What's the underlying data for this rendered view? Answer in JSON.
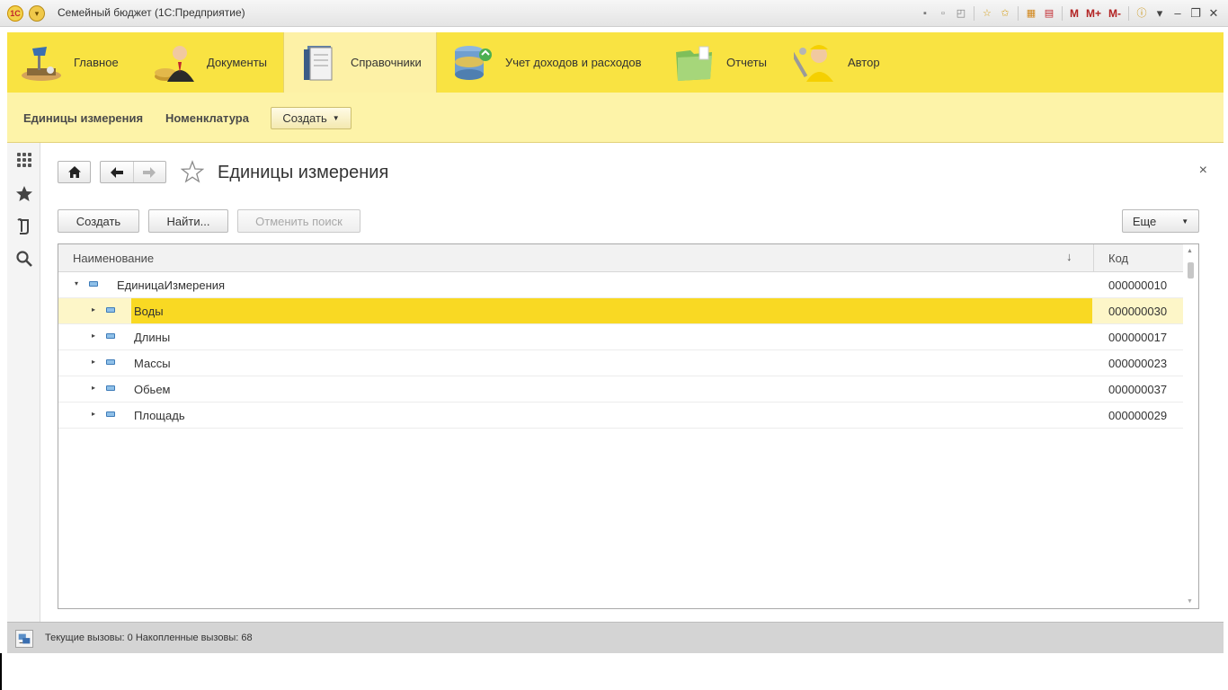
{
  "window": {
    "app_title": "Семейный бюджет (1С:Предприятие)",
    "logo_text": "1С",
    "toolbar_m": "M",
    "toolbar_m_plus": "M+",
    "toolbar_m_minus": "M-"
  },
  "sections": [
    {
      "label": "Главное",
      "icon": "desk-lamp-icon"
    },
    {
      "label": "Документы",
      "icon": "businessman-coins-icon"
    },
    {
      "label": "Справочники",
      "icon": "book-icon",
      "active": true
    },
    {
      "label": "Учет доходов и расходов",
      "icon": "database-coins-icon"
    },
    {
      "label": "Отчеты",
      "icon": "green-folder-icon"
    },
    {
      "label": "Автор",
      "icon": "worker-wrench-icon"
    }
  ],
  "section_nav": {
    "link1": "Единицы измерения",
    "link2": "Номенклатура",
    "create": "Создать"
  },
  "form": {
    "title": "Единицы измерения",
    "close": "×",
    "buttons": {
      "create": "Создать",
      "find": "Найти...",
      "cancel_search": "Отменить поиск",
      "more": "Еще"
    }
  },
  "table": {
    "col_name": "Наименование",
    "col_sort": "↓",
    "col_code": "Код",
    "root": {
      "name": "ЕдиницаИзмерения",
      "code": "000000010"
    },
    "rows": [
      {
        "name": "Воды",
        "code": "000000030",
        "selected": true
      },
      {
        "name": "Длины",
        "code": "000000017"
      },
      {
        "name": "Массы",
        "code": "000000023"
      },
      {
        "name": "Обьем",
        "code": "000000037"
      },
      {
        "name": "Площадь",
        "code": "000000029"
      }
    ]
  },
  "status": {
    "text": "Текущие вызовы: 0   Накопленные вызовы: 68"
  },
  "colors": {
    "section_bg": "#f9e342",
    "active_section_bg": "#fdf1a6",
    "selected_row": "#f9d923",
    "selected_row_light": "#fdf6c8"
  }
}
